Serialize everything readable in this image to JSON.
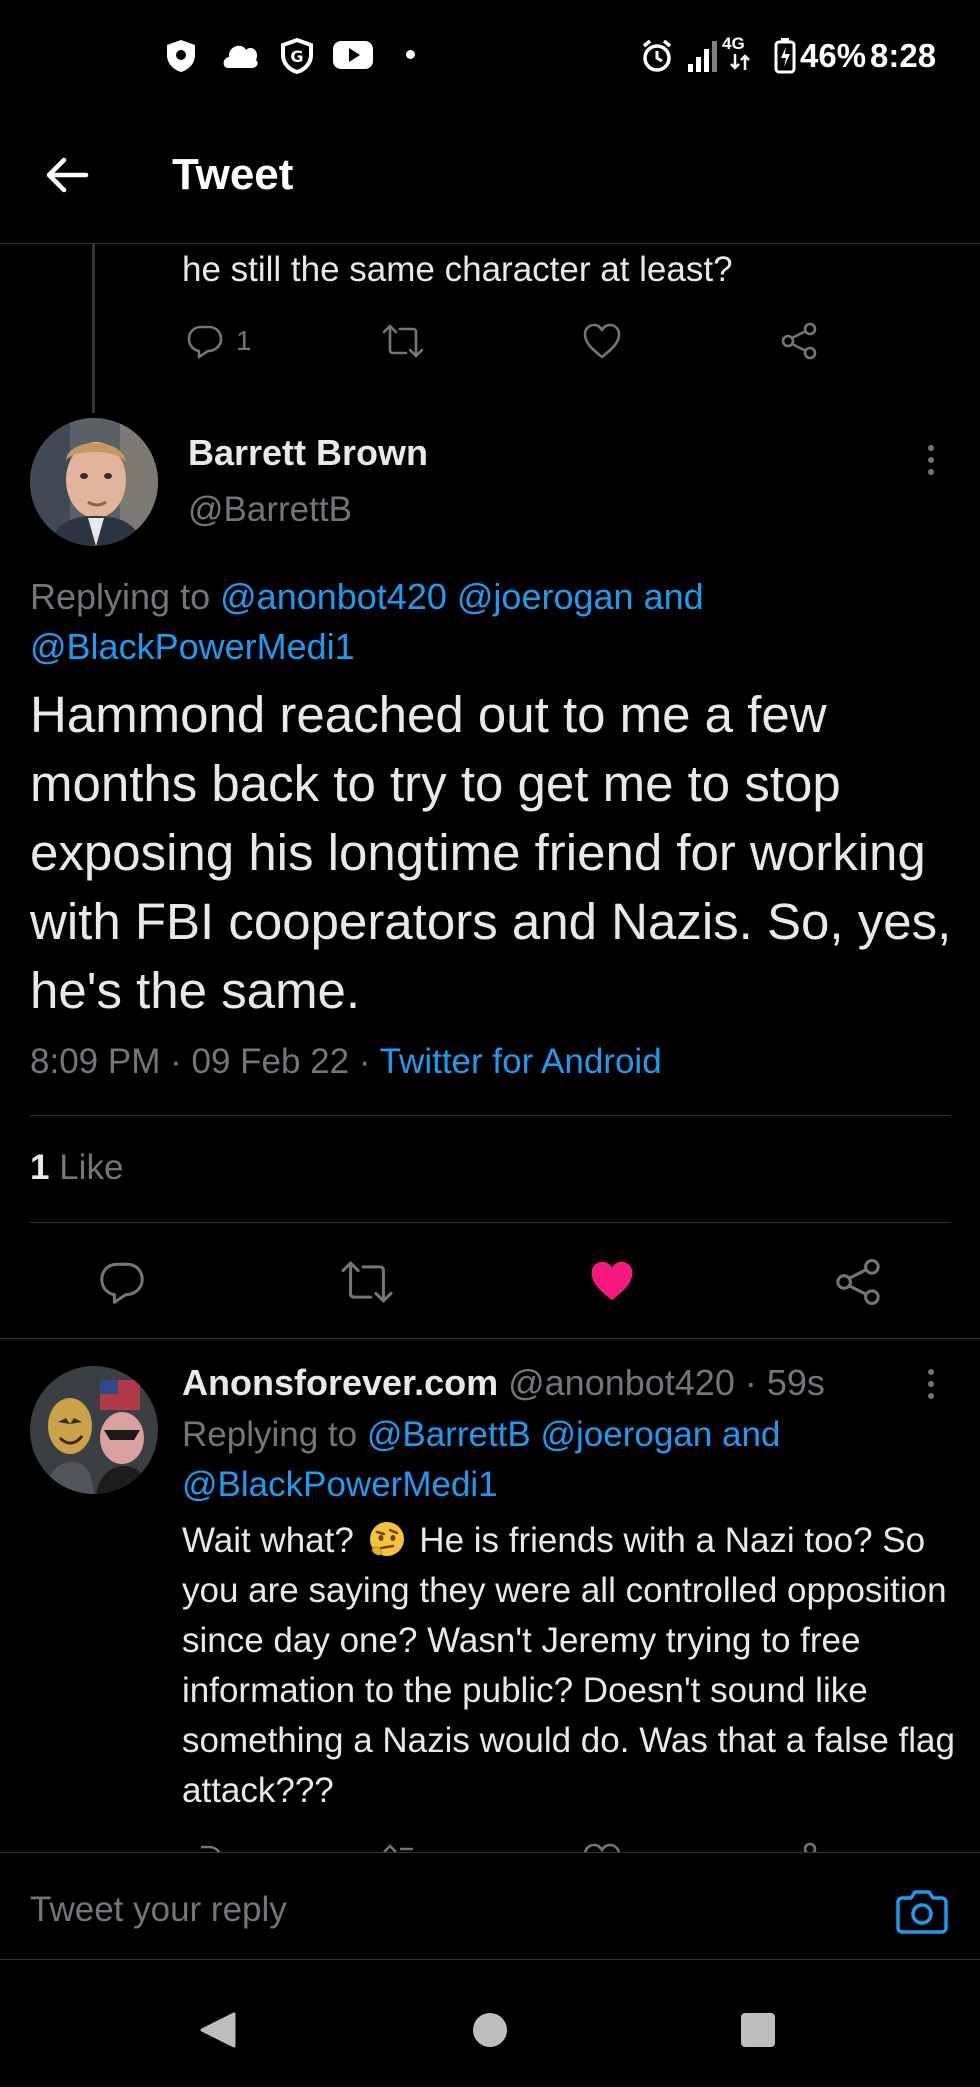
{
  "status_bar": {
    "network": "4G",
    "battery": "46%",
    "time": "8:28"
  },
  "header": {
    "title": "Tweet"
  },
  "previous_tweet": {
    "text": "he still the same character at least?",
    "reply_count": "1"
  },
  "main_tweet": {
    "author_name": "Barrett Brown",
    "author_handle": "@BarrettB",
    "replying_prefix": "Replying to",
    "replying_to_1": "@anonbot420",
    "replying_to_2": "@joerogan",
    "replying_and": "and",
    "replying_to_3": "@BlackPowerMedi1",
    "text": "Hammond reached out to me a few months back to try to get me to stop exposing his longtime friend for working with FBI cooperators and Nazis. So, yes, he's the same.",
    "time": "8:09 PM",
    "date": "09 Feb 22",
    "sep": "·",
    "source": "Twitter for Android",
    "like_count": "1",
    "like_label": "Like",
    "liked": true
  },
  "reply_tweet": {
    "author_name": "Anonsforever.com",
    "author_handle": "@anonbot420",
    "age": "59s",
    "sep": "·",
    "replying_prefix": "Replying to",
    "replying_to_1": "@BarrettB",
    "replying_to_2": "@joerogan",
    "replying_and": "and",
    "replying_to_3": "@BlackPowerMedi1",
    "text_before_emoji": "Wait what?",
    "text_after_emoji": "He is friends with a Nazi too? So you are saying they were all controlled opposition since day one? Wasn't Jeremy trying to free information to the public? Doesn't sound like something a Nazis would do. Was that a false flag attack???"
  },
  "reply_bar": {
    "placeholder": "Tweet your reply"
  },
  "colors": {
    "accent": "#1d9bf0",
    "like": "#f91880",
    "muted": "#71767b",
    "text": "#e7e9ea",
    "background": "#000000"
  }
}
